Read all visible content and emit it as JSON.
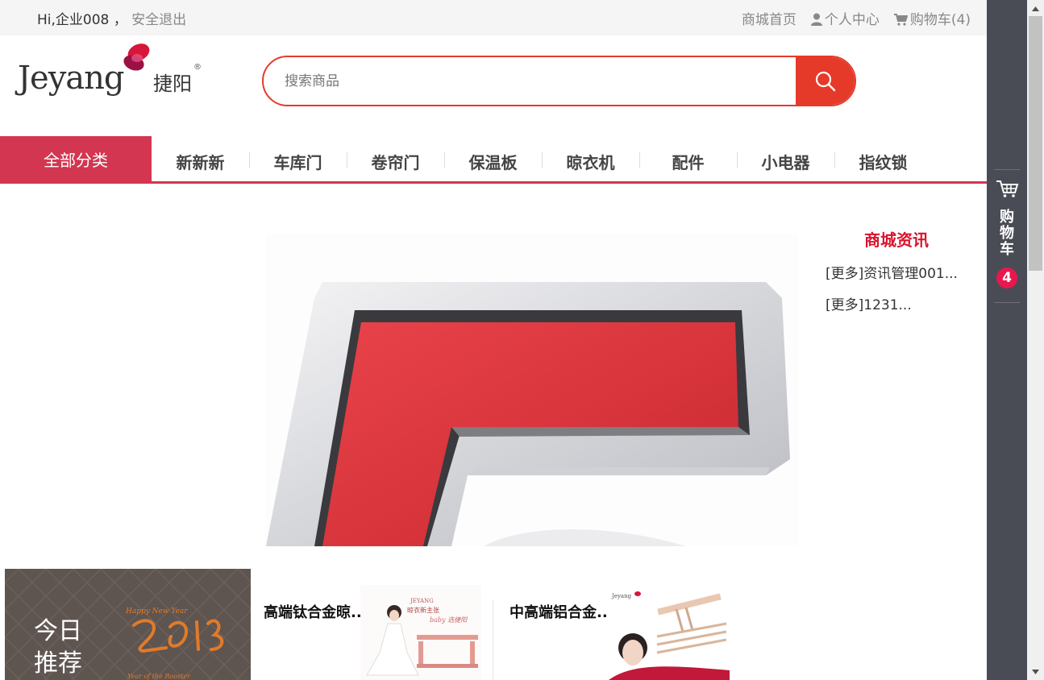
{
  "topbar": {
    "greeting": "Hi,企业008",
    "separator": "，",
    "logout": "安全退出",
    "links": {
      "home": "商城首页",
      "account": "个人中心",
      "cart": "购物车(4)"
    }
  },
  "logo": {
    "en": "Jeyang",
    "cn": "捷阳",
    "reg": "®"
  },
  "search": {
    "placeholder": "搜索商品",
    "value": ""
  },
  "nav": {
    "all_categories": "全部分类",
    "items": [
      "新新新",
      "车库门",
      "卷帘门",
      "保温板",
      "晾衣机",
      "配件",
      "小电器",
      "指纹锁"
    ]
  },
  "news": {
    "title": "商城资讯",
    "items": [
      "[更多]资讯管理001...",
      "[更多]1231..."
    ]
  },
  "recommend": {
    "label_line1": "今日",
    "label_line2": "推荐",
    "products": [
      {
        "name": "高端钛合金晾..."
      },
      {
        "name": "中高端铝合金..."
      }
    ]
  },
  "sidebar": {
    "cart_label": [
      "购",
      "物",
      "车"
    ],
    "cart_count": "4"
  },
  "colors": {
    "accent": "#d23650",
    "search_red": "#e53a2a",
    "news_red": "#d9142d",
    "sidebar": "#4a4c55",
    "badge": "#e8174d"
  },
  "icons": [
    "user-icon",
    "cart-icon",
    "search-icon",
    "sidebar-cart-icon",
    "scroll-up-icon",
    "scroll-down-icon"
  ]
}
